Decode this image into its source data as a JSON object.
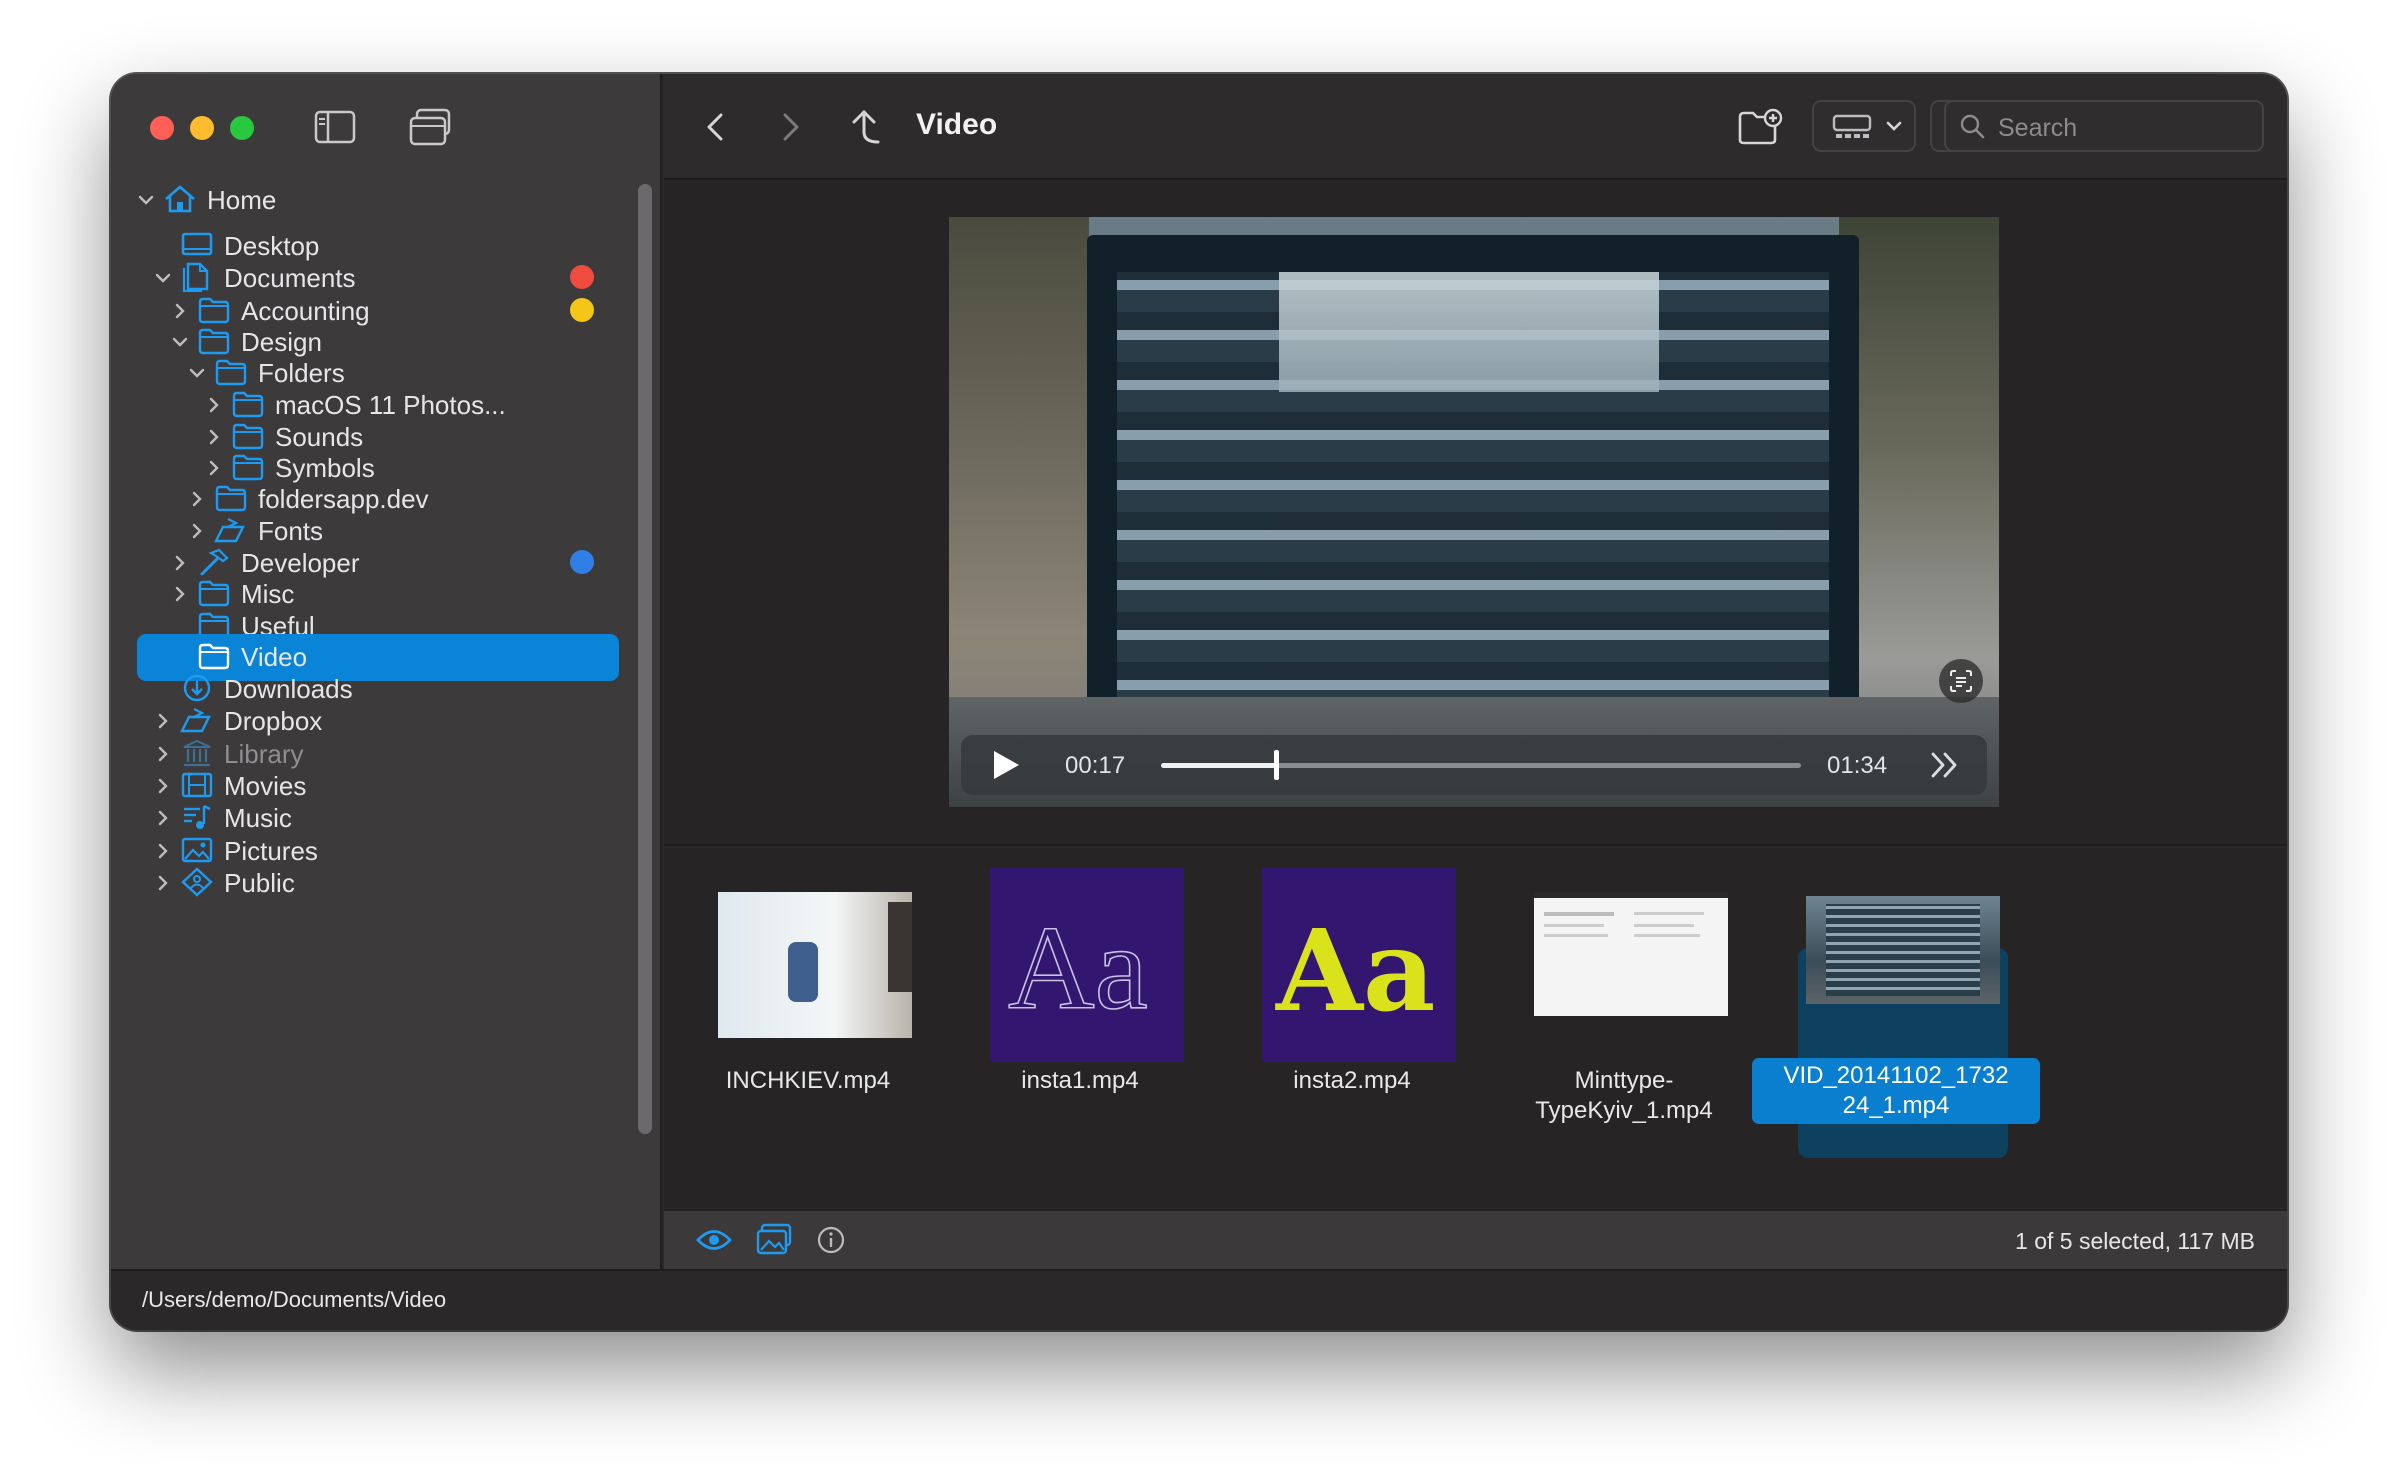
{
  "window": {
    "current_folder": "Video"
  },
  "sidebar": {
    "items": [
      {
        "label": "Home",
        "icon": "house-icon",
        "level": 0,
        "chevron": "down"
      },
      {
        "label": "Desktop",
        "icon": "desktop-icon",
        "level": 1,
        "chevron": "none"
      },
      {
        "label": "Documents",
        "icon": "documents-icon",
        "level": 1,
        "chevron": "down",
        "tag": "#ef4b3f"
      },
      {
        "label": "Accounting",
        "icon": "folder-icon",
        "level": 2,
        "chevron": "right",
        "tag": "#f5c518"
      },
      {
        "label": "Design",
        "icon": "folder-icon",
        "level": 2,
        "chevron": "down"
      },
      {
        "label": "Folders",
        "icon": "folder-icon",
        "level": 3,
        "chevron": "down"
      },
      {
        "label": "macOS 11 Photos...",
        "icon": "folder-icon",
        "level": 4,
        "chevron": "right"
      },
      {
        "label": "Sounds",
        "icon": "folder-icon",
        "level": 4,
        "chevron": "right"
      },
      {
        "label": "Symbols",
        "icon": "folder-icon",
        "level": 4,
        "chevron": "right"
      },
      {
        "label": "foldersapp.dev",
        "icon": "folder-icon",
        "level": 3,
        "chevron": "right"
      },
      {
        "label": "Fonts",
        "icon": "shared-folder-icon",
        "level": 3,
        "chevron": "right"
      },
      {
        "label": "Developer",
        "icon": "hammer-icon",
        "level": 2,
        "chevron": "right",
        "tag": "#2f7fe6"
      },
      {
        "label": "Misc",
        "icon": "folder-icon",
        "level": 2,
        "chevron": "right"
      },
      {
        "label": "Useful",
        "icon": "folder-icon",
        "level": 2,
        "chevron": "none"
      },
      {
        "label": "Video",
        "icon": "folder-icon",
        "level": 2,
        "chevron": "none",
        "selected": true
      },
      {
        "label": "Downloads",
        "icon": "download-icon",
        "level": 1,
        "chevron": "none"
      },
      {
        "label": "Dropbox",
        "icon": "shared-folder-icon",
        "level": 1,
        "chevron": "right"
      },
      {
        "label": "Library",
        "icon": "library-icon",
        "level": 1,
        "chevron": "right",
        "dim": true
      },
      {
        "label": "Movies",
        "icon": "film-icon",
        "level": 1,
        "chevron": "right"
      },
      {
        "label": "Music",
        "icon": "music-icon",
        "level": 1,
        "chevron": "right"
      },
      {
        "label": "Pictures",
        "icon": "photo-icon",
        "level": 1,
        "chevron": "right"
      },
      {
        "label": "Public",
        "icon": "public-icon",
        "level": 1,
        "chevron": "right"
      }
    ]
  },
  "toolbar": {
    "search_placeholder": "Search",
    "icons": [
      "back-icon",
      "forward-icon",
      "up-icon",
      "new-folder-icon",
      "view-mode-icon",
      "sort-icon",
      "search-icon"
    ]
  },
  "player": {
    "current_time": "00:17",
    "duration": "01:34",
    "progress": 0.18
  },
  "files": [
    {
      "name_lines": [
        "INCHKIEV.mp4"
      ]
    },
    {
      "name_lines": [
        "insta1.mp4"
      ]
    },
    {
      "name_lines": [
        "insta2.mp4"
      ]
    },
    {
      "name_lines": [
        "Minttype-",
        "TypeKyiv_1.mp4"
      ]
    },
    {
      "name_lines": [
        "VID_20141102_1732",
        "24_1.mp4"
      ],
      "selected": true
    }
  ],
  "statusbar": {
    "status": "1 of 5 selected, 117 MB"
  },
  "pathbar": {
    "path": "/Users/demo/Documents/Video"
  },
  "colors": {
    "accent": "#0a84d6",
    "sidebar_bg": "#3c3a3b",
    "content_bg": "#262425",
    "icon_blue": "#1e9bf0"
  }
}
